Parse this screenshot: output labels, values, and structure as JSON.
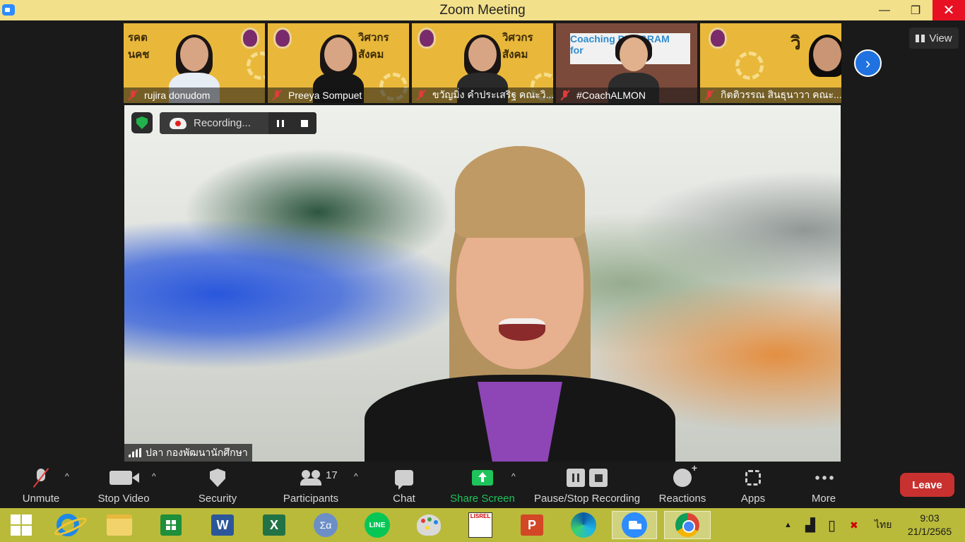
{
  "window": {
    "title": "Zoom Meeting",
    "controls": [
      "minimize-icon",
      "restore-icon",
      "close-icon"
    ],
    "minimize_glyph": "—",
    "restore_glyph": "❐",
    "close_glyph": "✕"
  },
  "thumbnails": [
    {
      "name": "rujira donudom",
      "muted": true,
      "banner": "รคต\nนคช"
    },
    {
      "name": "Preeya Sompuet",
      "muted": true,
      "banner": "วิศวกร\nสังคม"
    },
    {
      "name": "ขวัญมิ่ง คำประเสริฐ คณะวิ...",
      "muted": true,
      "banner": "วิศวกร\nสังคม"
    },
    {
      "name": "#CoachALMON",
      "muted": true,
      "banner": "Coaching PROGRAM\nfor"
    },
    {
      "name": "กิตติวรรณ สินธุนาวา คณะ...",
      "muted": true,
      "banner": "วิ"
    }
  ],
  "gallery": {
    "next_glyph": "›",
    "view_label": "View"
  },
  "main_video": {
    "recording_label": "Recording...",
    "speaker_name": "ปลา  กองพัฒนานักศึกษา"
  },
  "toolbar": {
    "unmute": "Unmute",
    "stop_video": "Stop Video",
    "security": "Security",
    "participants": "Participants",
    "participants_count": "17",
    "chat": "Chat",
    "share_screen": "Share Screen",
    "pause_stop_recording": "Pause/Stop Recording",
    "reactions": "Reactions",
    "apps": "Apps",
    "more": "More",
    "leave": "Leave",
    "caret": "^"
  },
  "taskbar": {
    "apps": [
      "start-icon",
      "internet-explorer-icon",
      "file-explorer-icon",
      "store-icon",
      "word-icon",
      "excel-icon",
      "math-input-icon",
      "line-icon",
      "paint-icon",
      "lisrel-icon",
      "powerpoint-icon",
      "edge-icon",
      "zoom-icon",
      "chrome-icon"
    ],
    "word_letter": "W",
    "excel_letter": "X",
    "ppt_letter": "P",
    "math_glyph": "Σα",
    "line_text": "LINE",
    "lisrel_text": "LISREL",
    "tray_up_glyph": "▲",
    "signal_glyph": "▟",
    "battery_glyph": "▯",
    "alert_glyph": "✖",
    "language": "ไทย",
    "time": "9:03",
    "date": "21/1/2565"
  },
  "colors": {
    "titlebar": "#f3e08a",
    "close": "#e81123",
    "share_green": "#1fc35b",
    "leave_red": "#c8312f",
    "taskbar": "#b9ba3a",
    "thumb_bg": "#e9b83a"
  }
}
